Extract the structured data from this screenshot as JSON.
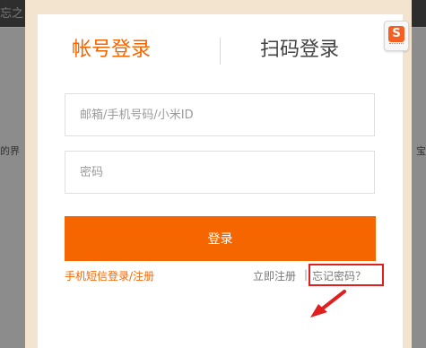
{
  "background": {
    "topbar_text": "忘之",
    "left_text": "的界",
    "right_text": "宝"
  },
  "tabs": {
    "account_login": "帐号登录",
    "qr_login": "扫码登录"
  },
  "ime": {
    "glyph": "S"
  },
  "form": {
    "account_placeholder": "邮箱/手机号码/小米ID",
    "password_placeholder": "密码",
    "login_label": "登录"
  },
  "links": {
    "sms": "手机短信登录/注册",
    "register": "立即注册",
    "separator": "|",
    "forgot": "忘记密码？"
  },
  "colors": {
    "accent": "#f56600",
    "annotation": "#e02020"
  }
}
